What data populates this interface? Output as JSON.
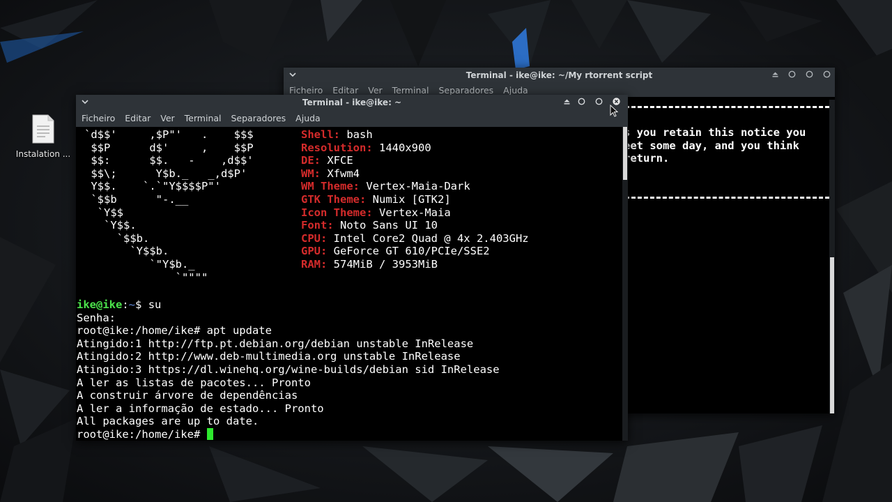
{
  "desktop": {
    "icon_label": "Instalation ..."
  },
  "back_window": {
    "title": "Terminal - ike@ike: ~/My rtorrent script",
    "menu": [
      "Ficheiro",
      "Editar",
      "Ver",
      "Terminal",
      "Separadores",
      "Ajuda"
    ],
    "text_lines": [
      "s you retain this notice you",
      "eet some day, and you think",
      "return."
    ]
  },
  "front_window": {
    "title": "Terminal - ike@ike: ~",
    "menu": [
      "Ficheiro",
      "Editar",
      "Ver",
      "Terminal",
      "Separadores",
      "Ajuda"
    ],
    "ascii": [
      "`d$$'     ,$P\"'   .    $$$",
      " $$P      d$'     ,    $$P",
      " $$:      $$.   -    ,d$$'",
      " $$\\;      Y$b._   _,d$P'",
      " Y$$.    `.`\"Y$$$$P\"'",
      " `$$b      \"-.__",
      "  `Y$$",
      "   `Y$$.",
      "     `$$b.",
      "       `Y$$b.",
      "          `\"Y$b._",
      "              `\"\"\"\""
    ],
    "sysinfo": [
      {
        "key": "Shell:",
        "value": "bash"
      },
      {
        "key": "Resolution:",
        "value": "1440x900"
      },
      {
        "key": "DE:",
        "value": "XFCE"
      },
      {
        "key": "WM:",
        "value": "Xfwm4"
      },
      {
        "key": "WM Theme:",
        "value": "Vertex-Maia-Dark"
      },
      {
        "key": "GTK Theme:",
        "value": "Numix [GTK2]"
      },
      {
        "key": "Icon Theme:",
        "value": "Vertex-Maia"
      },
      {
        "key": "Font:",
        "value": "Noto Sans UI 10"
      },
      {
        "key": "CPU:",
        "value": "Intel Core2 Quad @ 4x 2.403GHz"
      },
      {
        "key": "GPU:",
        "value": "GeForce GT 610/PCIe/SSE2"
      },
      {
        "key": "RAM:",
        "value": "574MiB / 3953MiB"
      }
    ],
    "prompt_user": "ike@ike",
    "prompt_sep": ":",
    "prompt_path": "~",
    "prompt_symbol": "$",
    "command_su": "su",
    "output_lines": [
      "Senha:",
      "root@ike:/home/ike# apt update",
      "Atingido:1 http://ftp.pt.debian.org/debian unstable InRelease",
      "Atingido:2 http://www.deb-multimedia.org unstable InRelease",
      "Atingido:3 https://dl.winehq.org/wine-builds/debian sid InRelease",
      "A ler as listas de pacotes... Pronto",
      "A construir árvore de dependências",
      "A ler a informação de estado... Pronto",
      "All packages are up to date."
    ],
    "final_prompt": "root@ike:/home/ike# "
  },
  "colors": {
    "key_red": "#d42b2b",
    "prompt_green": "#4be24b",
    "cursor_green": "#2ee82e",
    "titlebar": "#2e3338"
  }
}
